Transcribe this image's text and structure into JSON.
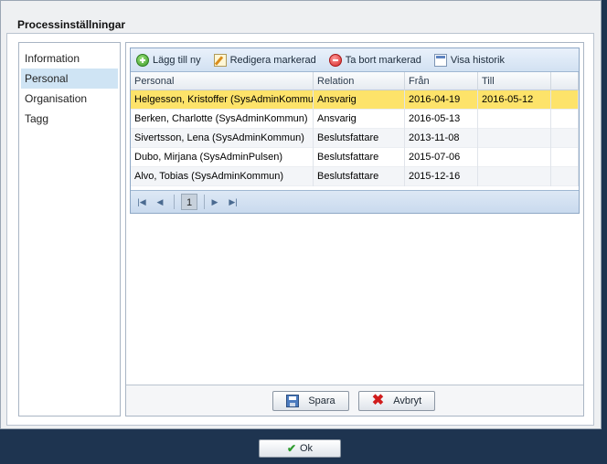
{
  "dialog": {
    "title": "Processinställningar"
  },
  "nav": {
    "items": [
      {
        "label": "Information",
        "active": false
      },
      {
        "label": "Personal",
        "active": true
      },
      {
        "label": "Organisation",
        "active": false
      },
      {
        "label": "Tagg",
        "active": false
      }
    ]
  },
  "toolbar": {
    "add_label": "Lägg till ny",
    "edit_label": "Redigera markerad",
    "delete_label": "Ta bort markerad",
    "history_label": "Visa historik"
  },
  "table": {
    "columns": [
      "Personal",
      "Relation",
      "Från",
      "Till"
    ],
    "rows": [
      {
        "personal": "Helgesson, Kristoffer (SysAdminKommun)",
        "relation": "Ansvarig",
        "fran": "2016-04-19",
        "till": "2016-05-12",
        "selected": true
      },
      {
        "personal": "Berken, Charlotte (SysAdminKommun)",
        "relation": "Ansvarig",
        "fran": "2016-05-13",
        "till": ""
      },
      {
        "personal": "Sivertsson, Lena (SysAdminKommun)",
        "relation": "Beslutsfattare",
        "fran": "2013-11-08",
        "till": ""
      },
      {
        "personal": "Dubo, Mirjana (SysAdminPulsen)",
        "relation": "Beslutsfattare",
        "fran": "2015-07-06",
        "till": ""
      },
      {
        "personal": "Alvo, Tobias (SysAdminKommun)",
        "relation": "Beslutsfattare",
        "fran": "2015-12-16",
        "till": ""
      }
    ]
  },
  "pager": {
    "current_page": "1"
  },
  "actions": {
    "save_label": "Spara",
    "cancel_label": "Avbryt"
  },
  "ok_label": "Ok",
  "colors": {
    "selected_row": "#fde36a",
    "background": "#1e3450",
    "accent": "#cfe4f4"
  }
}
